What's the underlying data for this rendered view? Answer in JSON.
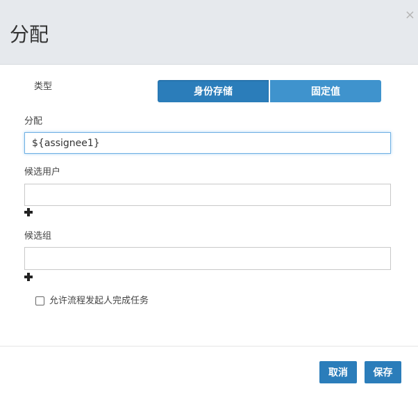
{
  "dialog": {
    "title": "分配",
    "close_symbol": "×"
  },
  "type_row": {
    "label": "类型",
    "options": [
      "身份存储",
      "固定值"
    ],
    "selected": "身份存储"
  },
  "assignee": {
    "label": "分配",
    "value": "${assignee1}"
  },
  "candidate_users": {
    "label": "候选用户",
    "value": "",
    "add_icon": "plus-icon"
  },
  "candidate_groups": {
    "label": "候选组",
    "value": "",
    "add_icon": "plus-icon"
  },
  "allow_initiator": {
    "label": "允许流程发起人完成任务",
    "checked": false
  },
  "footer": {
    "cancel_label": "取消",
    "save_label": "保存"
  },
  "colors": {
    "primary": "#2b7dba",
    "secondary": "#3f93cd",
    "header_bg": "#e6e9ed"
  }
}
